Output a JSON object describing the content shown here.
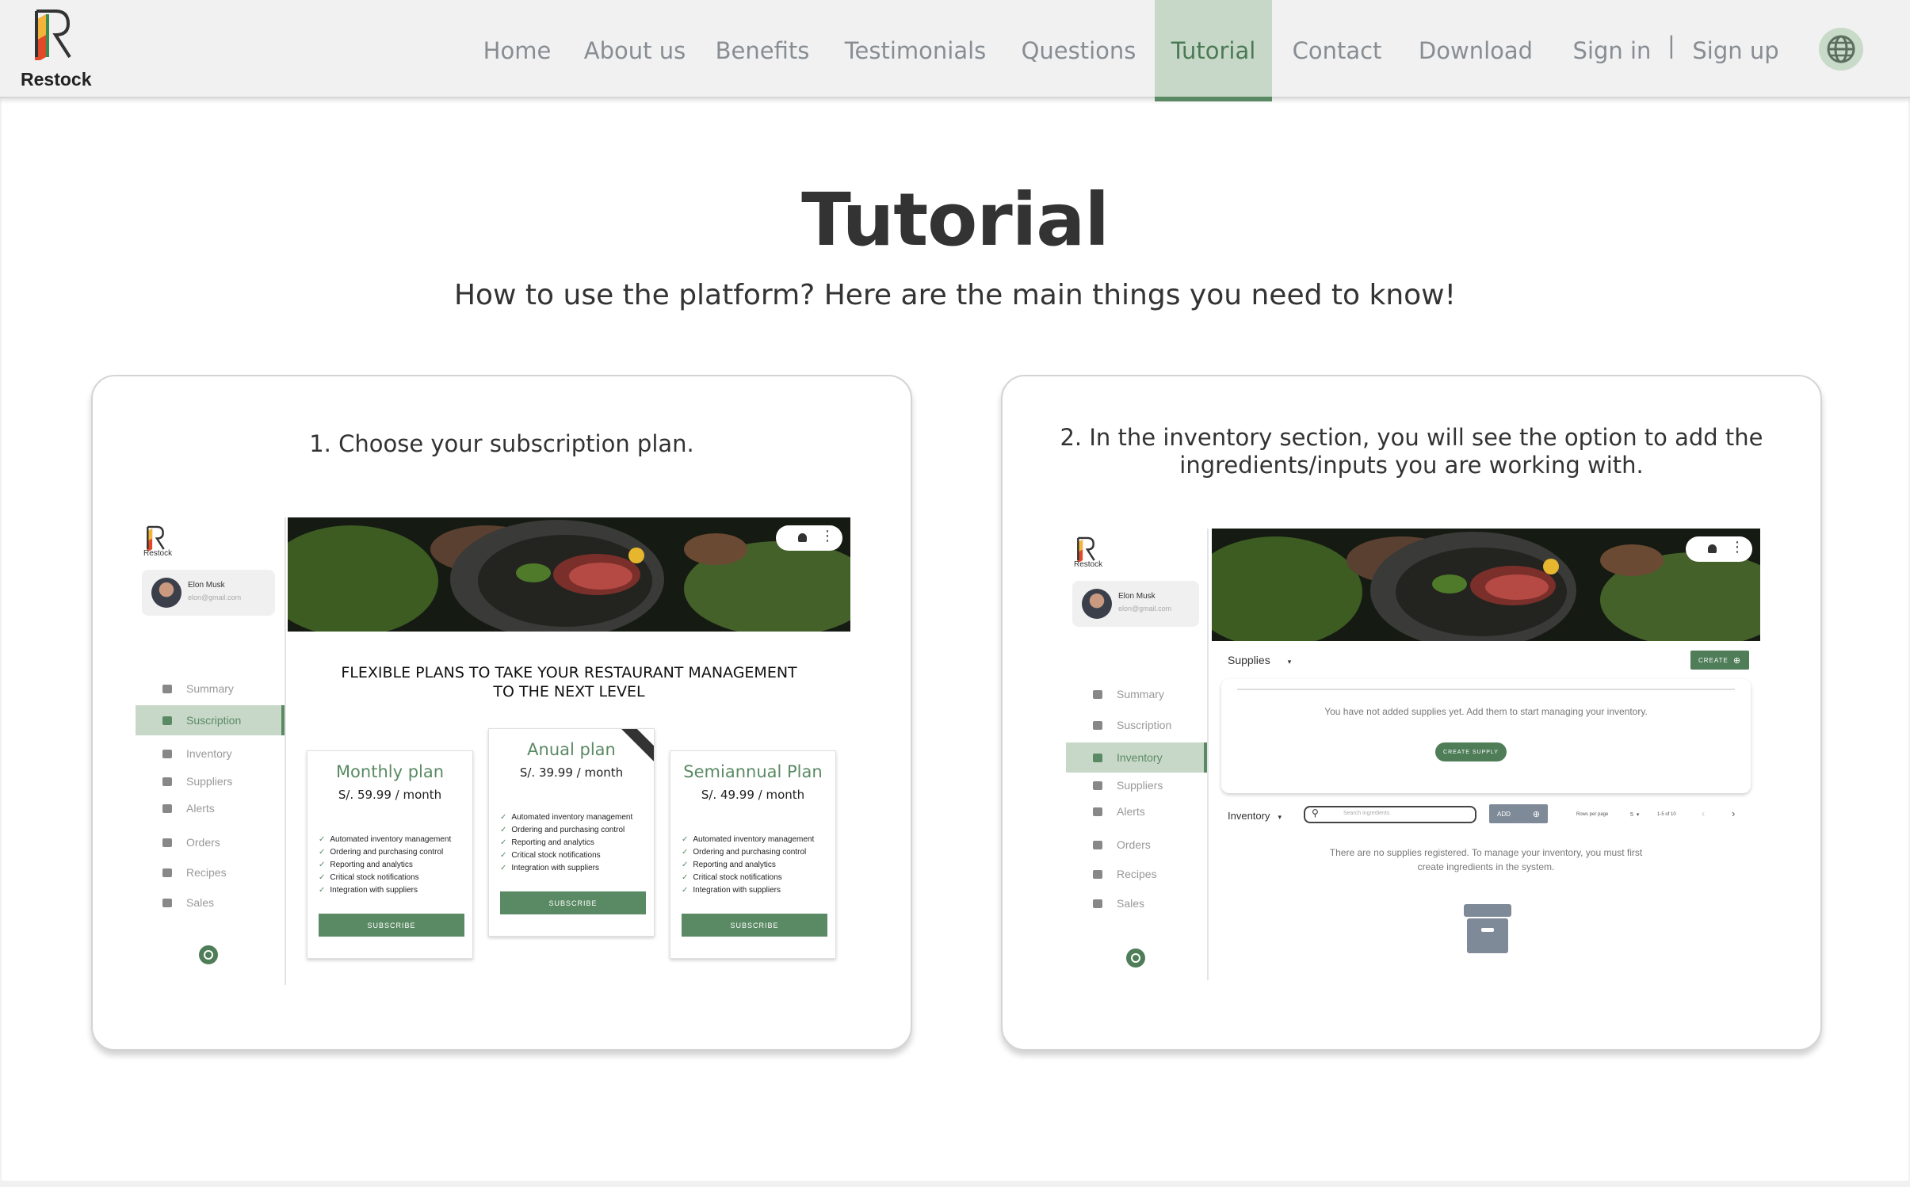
{
  "brand": {
    "name": "Restock"
  },
  "nav": {
    "items": [
      "Home",
      "About us",
      "Benefits",
      "Testimonials",
      "Questions",
      "Tutorial",
      "Contact",
      "Download"
    ],
    "active": "Tutorial",
    "sign_in": "Sign in",
    "separator": "|",
    "sign_up": "Sign up"
  },
  "page": {
    "title": "Tutorial",
    "subtitle": "How to use the platform? Here are the main things you need to know!"
  },
  "steps": [
    {
      "title": "1. Choose your subscription plan.",
      "app": {
        "logo_text": "Restock",
        "user_name": "Elon Musk",
        "user_email": "elon@gmail.com",
        "menu": [
          "Summary",
          "Suscription",
          "Inventory",
          "Suppliers",
          "Alerts",
          "Orders",
          "Recipes",
          "Sales"
        ],
        "active_menu": "Suscription",
        "plans_heading_line1": "FLEXIBLE PLANS TO TAKE YOUR RESTAURANT MANAGEMENT",
        "plans_heading_line2": "TO THE NEXT LEVEL",
        "plans": [
          {
            "name": "Monthly plan",
            "price": "S/. 59.99 / month",
            "button": "SUBSCRIBE"
          },
          {
            "name": "Anual plan",
            "price": "S/. 39.99 / month",
            "button": "SUBSCRIBE"
          },
          {
            "name": "Semiannual Plan",
            "price": "S/. 49.99 / month",
            "button": "SUBSCRIBE"
          }
        ],
        "features": [
          "Automated inventory management",
          "Ordering and purchasing control",
          "Reporting and analytics",
          "Critical stock notifications",
          "Integration with suppliers"
        ]
      }
    },
    {
      "title": "2. In the inventory section, you will see the option to add the ingredients/inputs you are working with.",
      "app": {
        "logo_text": "Restock",
        "user_name": "Elon Musk",
        "user_email": "elon@gmail.com",
        "menu": [
          "Summary",
          "Suscription",
          "Inventory",
          "Suppliers",
          "Alerts",
          "Orders",
          "Recipes",
          "Sales"
        ],
        "active_menu": "Inventory",
        "supplies_label": "Supplies",
        "create_label": "CREATE",
        "empty_supplies": "You have not added supplies yet. Add them to start managing your inventory.",
        "create_supply_label": "CREATE SUPPLY",
        "inventory_label": "Inventory",
        "search_placeholder": "Search ingredients",
        "add_label": "ADD",
        "rows_per_page": "Rows per page",
        "rows_value": "5",
        "range": "1-5 of 10",
        "empty_inventory_line1": "There are no supplies registered. To manage your inventory, you must first",
        "empty_inventory_line2": "create ingredients in the system."
      }
    }
  ],
  "colors": {
    "accent": "#5a8a64",
    "active_bg": "#c8d8c8",
    "nav_text": "#888d93"
  },
  "icons": {
    "globe": "globe-icon",
    "archive": "archive-icon",
    "search": "search-icon"
  }
}
